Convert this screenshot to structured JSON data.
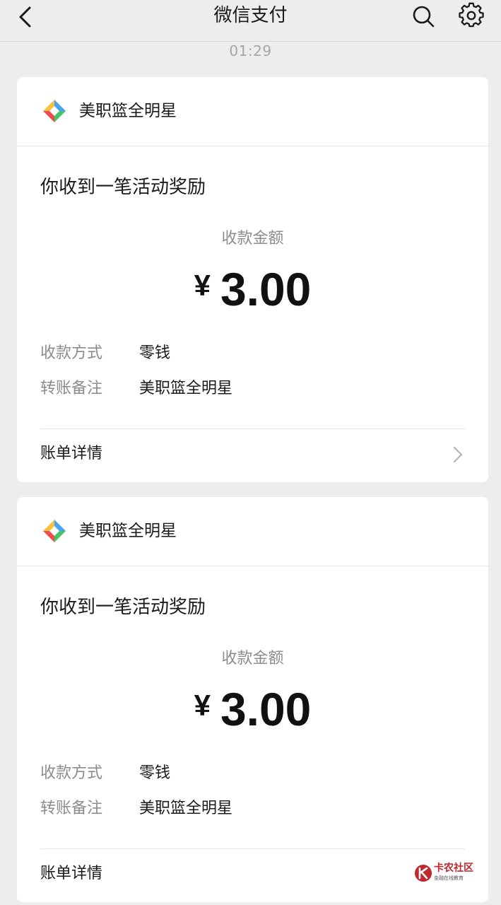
{
  "nav": {
    "title": "微信支付",
    "back_icon": "chevron-left-icon",
    "search_icon": "search-icon",
    "settings_icon": "gear-icon"
  },
  "timestamp": "01:29",
  "colors": {
    "background": "#ededed",
    "card": "#ffffff",
    "muted_text": "#8c8c8c",
    "watermark_red": "#c0282d"
  },
  "cards": [
    {
      "brand": "美职篮全明星",
      "headline": "你收到一笔活动奖励",
      "amount_label": "收款金额",
      "currency_symbol": "¥",
      "amount": "3.00",
      "rows": [
        {
          "key": "收款方式",
          "value": "零钱"
        },
        {
          "key": "转账备注",
          "value": "美职篮全明星"
        }
      ],
      "detail_label": "账单详情"
    },
    {
      "brand": "美职篮全明星",
      "headline": "你收到一笔活动奖励",
      "amount_label": "收款金额",
      "currency_symbol": "¥",
      "amount": "3.00",
      "rows": [
        {
          "key": "收款方式",
          "value": "零钱"
        },
        {
          "key": "转账备注",
          "value": "美职篮全明星"
        }
      ],
      "detail_label": "账单详情"
    }
  ],
  "watermark": {
    "name": "卡农社区",
    "tagline": "金融在线教育"
  }
}
